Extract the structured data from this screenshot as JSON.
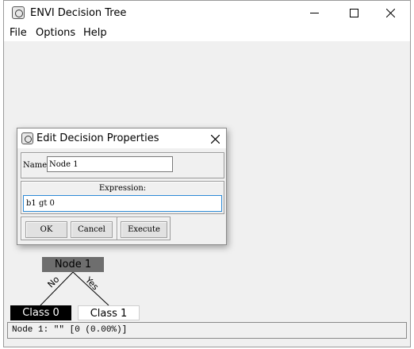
{
  "window": {
    "title": "ENVI Decision Tree",
    "titlebar_buttons": [
      "minimize",
      "maximize",
      "close"
    ]
  },
  "menu": {
    "items": [
      {
        "label": "File"
      },
      {
        "label": "Options"
      },
      {
        "label": "Help"
      }
    ]
  },
  "tree": {
    "root": {
      "label": "Node 1",
      "color": "#6e6e6e"
    },
    "no_label": "No",
    "yes_label": "Yes",
    "class0": {
      "label": "Class 0",
      "color": "#000000"
    },
    "class1": {
      "label": "Class 1",
      "color": "#ffffff"
    }
  },
  "status": {
    "text": "Node 1: \"\" [0 (0.00%)]"
  },
  "dialog": {
    "title": "Edit Decision Properties",
    "name_label": "Name",
    "name_value": "Node 1",
    "expression_label": "Expression:",
    "expression_value": "b1 gt 0",
    "ok_label": "OK",
    "cancel_label": "Cancel",
    "execute_label": "Execute"
  },
  "icons": [
    "app-icon",
    "minimize-icon",
    "maximize-icon",
    "close-icon",
    "dialog-app-icon",
    "dialog-close-icon"
  ]
}
